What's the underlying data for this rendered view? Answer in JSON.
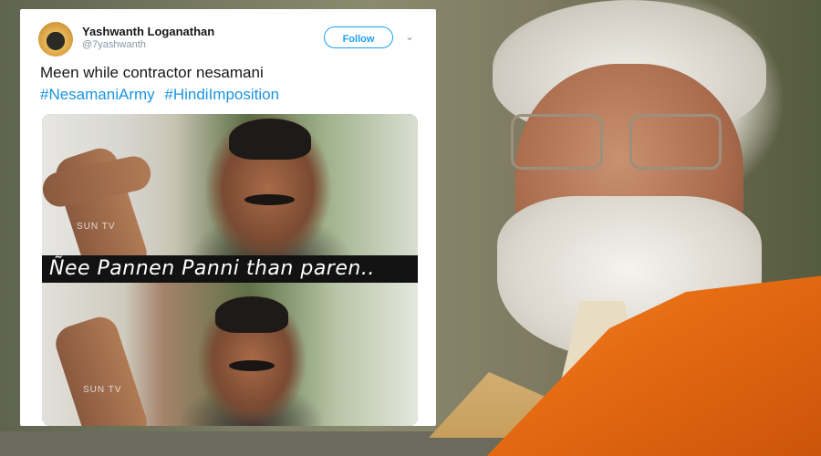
{
  "tweet": {
    "user_name": "Yashwanth Loganathan",
    "user_handle": "@7yashwanth",
    "follow_label": "Follow",
    "text_line": "Meen while contractor nesamani",
    "hashtags": [
      "#NesamaniArmy",
      "#HindiImposition"
    ],
    "meme": {
      "caption": "Ñee Pannen Panni than paren..",
      "watermark_top": "SUN TV",
      "watermark_bottom": "SUN TV"
    }
  },
  "icons": {
    "avatar": "user-avatar",
    "more": "chevron-down-icon"
  },
  "colors": {
    "link_blue": "#1b95e0",
    "follow_blue": "#1da1f2",
    "scarf_orange": "#e56a12"
  }
}
